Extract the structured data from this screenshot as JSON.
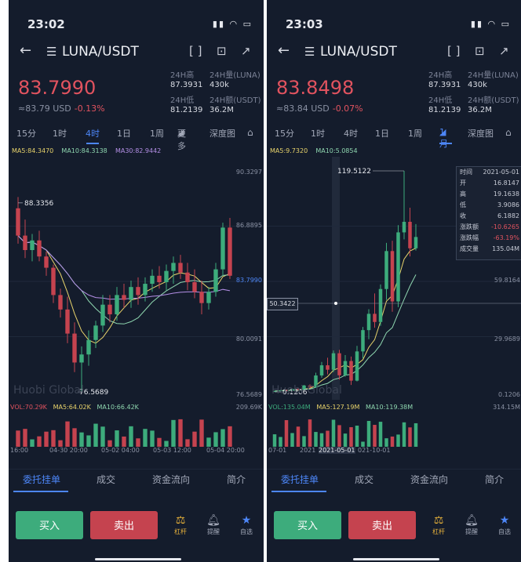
{
  "colors": {
    "bg": "#141c2c",
    "up": "#3dac7c",
    "down": "#c5434f",
    "accent": "#4d86f7",
    "ma5": "#e8d36b",
    "ma10": "#8fd7b0",
    "ma30": "#b48fe6"
  },
  "left": {
    "status_time": "23:02",
    "pair": "LUNA/USDT",
    "price": "83.7990",
    "usd": "≈83.79 USD",
    "change": "-0.13%",
    "stats": [
      {
        "label": "24H高",
        "value": "87.3931"
      },
      {
        "label": "24H量(LUNA)",
        "value": "430k"
      },
      {
        "label": "24H低",
        "value": "81.2139"
      },
      {
        "label": "24H额(USDT)",
        "value": "36.2M"
      }
    ],
    "tabs": [
      "15分",
      "1时",
      "4时",
      "1日",
      "1周",
      "更多",
      "深度图"
    ],
    "ma": {
      "ma5": "MA5:84.3470",
      "ma10": "MA10:84.3138",
      "ma30": "MA30:82.9442"
    },
    "y_labels": [
      "90.3297",
      "86.8895",
      "83.7990",
      "80.0091",
      "76.5689"
    ],
    "annotations": {
      "high": "88.3356",
      "low": "76.5689"
    },
    "vol": {
      "vol": "VOL:70.29K",
      "ma5": "MA5:64.02K",
      "ma10": "MA10:66.42K",
      "max": "209.69K"
    },
    "x_labels": [
      "16:00",
      "04-30 20:00",
      "05-02 04:00",
      "05-03 12:00",
      "05-04 20:00"
    ],
    "bottom_tabs": [
      "委托挂单",
      "成交",
      "资金流向",
      "简介"
    ],
    "buy": "买入",
    "sell": "卖出",
    "actions": [
      "杠杆",
      "提醒",
      "自选"
    ],
    "watermark": "Huobi Global"
  },
  "right": {
    "status_time": "23:03",
    "pair": "LUNA/USDT",
    "price": "83.8498",
    "usd": "≈83.84 USD",
    "change": "-0.07%",
    "stats": [
      {
        "label": "24H高",
        "value": "87.3931"
      },
      {
        "label": "24H量(LUNA)",
        "value": "430k"
      },
      {
        "label": "24H低",
        "value": "81.2139"
      },
      {
        "label": "24H额(USDT)",
        "value": "36.2M"
      }
    ],
    "tabs": [
      "15分",
      "1时",
      "4时",
      "1日",
      "1周",
      "1月",
      "深度图"
    ],
    "ma": {
      "ma5": "MA5:9.7320",
      "ma10": "MA10:5.0854"
    },
    "y_labels": [
      "59.8164",
      "29.9689",
      "0.1206"
    ],
    "annotations": {
      "high": "119.5122",
      "low": "0.1206",
      "crosshair": "50.3422"
    },
    "tooltip": [
      {
        "k": "时间",
        "v": "2021-05-01"
      },
      {
        "k": "开",
        "v": "16.8147"
      },
      {
        "k": "高",
        "v": "19.1638"
      },
      {
        "k": "低",
        "v": "3.9086"
      },
      {
        "k": "收",
        "v": "6.1882"
      },
      {
        "k": "涨跌额",
        "v": "-10.6265"
      },
      {
        "k": "涨跌幅",
        "v": "-63.19%"
      },
      {
        "k": "成交量",
        "v": "135.04M"
      }
    ],
    "vol": {
      "vol": "VOL:135.04M",
      "ma5": "MA5:127.19M",
      "ma10": "MA10:119.38M",
      "max": "314.15M"
    },
    "x_labels": [
      "07-01",
      "2021",
      "2021-05-01",
      "021-10-01"
    ],
    "bottom_tabs": [
      "委托挂单",
      "成交",
      "资金流向",
      "简介"
    ],
    "buy": "买入",
    "sell": "卖出",
    "actions": [
      "杠杆",
      "提醒",
      "自选"
    ],
    "watermark": "Huobi Global"
  },
  "chart_data": [
    {
      "type": "candlestick",
      "ylim": [
        76.5689,
        90.3297
      ],
      "series": [
        {
          "name": "price",
          "values": [
            [
              88.0,
              88.7,
              85.8,
              86.3
            ],
            [
              86.3,
              87.3,
              84.9,
              85.4
            ],
            [
              85.4,
              86.4,
              84.7,
              86.0
            ],
            [
              86.0,
              86.6,
              84.7,
              85.0
            ],
            [
              85.0,
              85.3,
              83.8,
              84.3
            ],
            [
              84.3,
              84.5,
              82.1,
              82.6
            ],
            [
              82.6,
              83.0,
              81.2,
              81.7
            ],
            [
              81.7,
              82.5,
              79.6,
              80.2
            ],
            [
              80.2,
              80.9,
              77.8,
              78.4
            ],
            [
              78.4,
              79.4,
              76.6,
              78.9
            ],
            [
              78.9,
              80.4,
              78.2,
              79.8
            ],
            [
              79.8,
              81.0,
              79.3,
              80.7
            ],
            [
              80.7,
              82.6,
              80.3,
              82.0
            ],
            [
              82.0,
              82.6,
              80.9,
              81.4
            ],
            [
              81.4,
              83.1,
              81.0,
              82.6
            ],
            [
              82.6,
              83.3,
              81.8,
              82.3
            ],
            [
              82.3,
              83.5,
              81.8,
              83.1
            ],
            [
              83.1,
              83.7,
              82.0,
              82.6
            ],
            [
              82.6,
              83.7,
              82.2,
              83.3
            ],
            [
              83.3,
              84.2,
              82.8,
              83.8
            ],
            [
              83.8,
              84.4,
              83.0,
              83.4
            ],
            [
              83.4,
              84.5,
              82.9,
              84.1
            ],
            [
              84.1,
              85.0,
              83.3,
              84.6
            ],
            [
              84.6,
              85.1,
              83.6,
              84.0
            ],
            [
              84.0,
              84.6,
              82.9,
              83.4
            ],
            [
              83.4,
              84.2,
              82.4,
              82.8
            ],
            [
              82.8,
              83.5,
              81.4,
              82.1
            ],
            [
              82.1,
              83.1,
              81.7,
              82.8
            ],
            [
              82.8,
              84.6,
              82.5,
              84.2
            ],
            [
              84.2,
              87.1,
              83.8,
              86.8
            ],
            [
              86.8,
              87.4,
              83.6,
              83.8
            ]
          ]
        }
      ]
    },
    {
      "type": "candlestick",
      "ylim": [
        0.1206,
        119.5122
      ],
      "series": [
        {
          "name": "price",
          "values": [
            [
              0.3,
              0.8,
              0.12,
              0.6
            ],
            [
              0.6,
              1.2,
              0.5,
              1.0
            ],
            [
              1.0,
              1.4,
              0.7,
              0.8
            ],
            [
              0.8,
              1.9,
              0.7,
              1.7
            ],
            [
              1.7,
              2.1,
              1.0,
              1.3
            ],
            [
              1.3,
              3.9,
              1.2,
              3.6
            ],
            [
              3.6,
              4.2,
              2.0,
              2.6
            ],
            [
              2.6,
              10.5,
              2.4,
              9.0
            ],
            [
              9.0,
              16.3,
              7.8,
              14.5
            ],
            [
              14.5,
              18.6,
              9.6,
              12.1
            ],
            [
              12.1,
              22.5,
              10.8,
              21.0
            ],
            [
              21.0,
              22.8,
              6.8,
              9.1
            ],
            [
              9.1,
              20.0,
              8.4,
              16.8
            ],
            [
              16.8,
              19.2,
              3.9,
              6.2
            ],
            [
              6.2,
              25.0,
              5.8,
              22.0
            ],
            [
              22.0,
              35.2,
              18.2,
              33.5
            ],
            [
              33.5,
              44.8,
              28.6,
              42.3
            ],
            [
              42.3,
              53.3,
              34.8,
              37.9
            ],
            [
              37.9,
              58.2,
              35.8,
              55.7
            ],
            [
              55.7,
              80.6,
              49.8,
              76.2
            ],
            [
              76.2,
              81.8,
              43.4,
              49.0
            ],
            [
              49.0,
              90.2,
              45.9,
              86.3
            ],
            [
              86.3,
              119.5,
              82.5,
              92.0
            ],
            [
              92.0,
              99.6,
              73.3,
              77.7
            ],
            [
              77.7,
              90.8,
              76.5,
              83.8
            ]
          ]
        }
      ]
    }
  ]
}
